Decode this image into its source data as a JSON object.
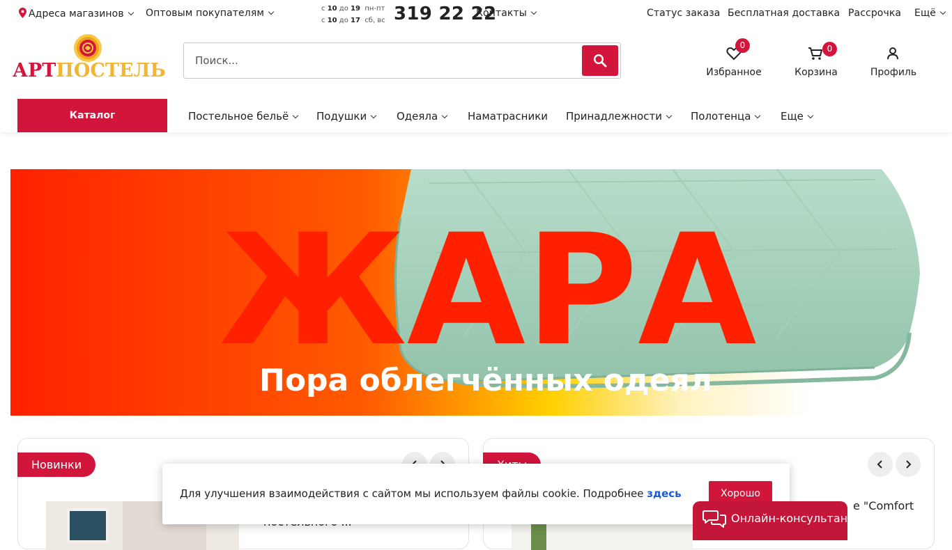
{
  "topbar": {
    "stores": "Адреса магазинов",
    "wholesale": "Оптовым покупателям",
    "hours": [
      {
        "from_label": "с",
        "from": "10",
        "to_label": "до",
        "to": "19",
        "days": "пн-пт"
      },
      {
        "from_label": "с",
        "from": "10",
        "to_label": "до",
        "to": "17",
        "days": "сб, вс"
      }
    ],
    "phone": "319 22 22",
    "contacts": "Контакты",
    "order_status": "Статус заказа",
    "free_delivery": "Бесплатная доставка",
    "installment": "Рассрочка",
    "more": "Ещё"
  },
  "logo": {
    "part1": "АРТ",
    "part2": "ПОСТЕЛЬ"
  },
  "search": {
    "placeholder": "Поиск..."
  },
  "header_icons": {
    "favorites": {
      "label": "Избранное",
      "count": "0"
    },
    "cart": {
      "label": "Корзина",
      "count": "0"
    },
    "profile": {
      "label": "Профиль"
    }
  },
  "nav": {
    "catalog": "Каталог",
    "items": [
      "Постельное бельё",
      "Подушки",
      "Одеяла",
      "Наматрасники",
      "Принадлежности",
      "Полотенца",
      "Еще"
    ]
  },
  "banner": {
    "headline": "ЖАРА",
    "subline": "Пора облегчённых одеял"
  },
  "sections": {
    "new": {
      "title": "Новинки",
      "product_text": "постельного ..."
    },
    "hits": {
      "title": "Хиты",
      "product_text": "е \"Comfort"
    }
  },
  "cookie": {
    "text": "Для улучшения взаимодействия с сайтом мы используем файлы cookie. Подробнее",
    "link": "здесь",
    "button": "Хорошо"
  },
  "consultant": {
    "label": "Онлайн-консультант"
  },
  "colors": {
    "accent": "#d2153b",
    "link": "#1a5bd6",
    "banner_red": "#ff2a00",
    "blanket": "#a7d4bd"
  }
}
